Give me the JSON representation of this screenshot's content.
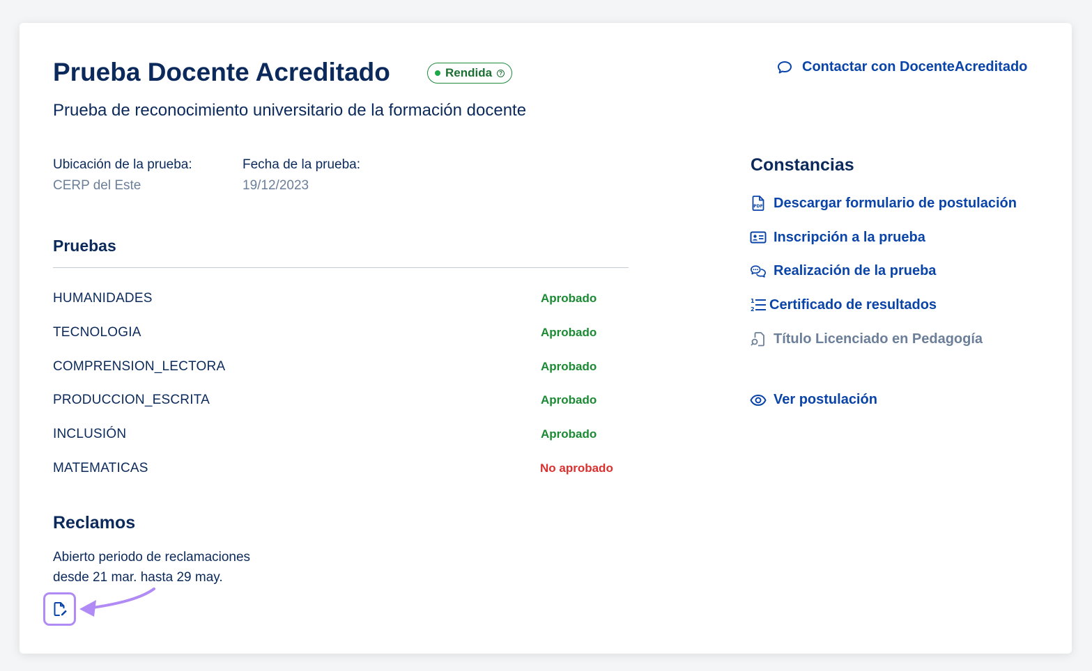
{
  "header": {
    "title": "Prueba Docente Acreditado",
    "status_badge": "Rendida",
    "status_help_icon": "question-circle-icon",
    "subtitle": "Prueba de reconocimiento universitario de la formación docente",
    "contact_link": "Contactar con DocenteAcreditado"
  },
  "meta": {
    "location_label": "Ubicación de la prueba:",
    "location_value": "CERP del Este",
    "date_label": "Fecha de la prueba:",
    "date_value": "19/12/2023"
  },
  "tests": {
    "title": "Pruebas",
    "rows": [
      {
        "name": "HUMANIDADES",
        "status": "Aprobado",
        "passed": true
      },
      {
        "name": "TECNOLOGIA",
        "status": "Aprobado",
        "passed": true
      },
      {
        "name": "COMPRENSION_LECTORA",
        "status": "Aprobado",
        "passed": true
      },
      {
        "name": "PRODUCCION_ESCRITA",
        "status": "Aprobado",
        "passed": true
      },
      {
        "name": "INCLUSIÓN",
        "status": "Aprobado",
        "passed": true
      },
      {
        "name": "MATEMATICAS",
        "status": "No aprobado",
        "passed": false
      }
    ]
  },
  "claims": {
    "title": "Reclamos",
    "line1": "Abierto periodo de reclamaciones",
    "line2": "desde 21 mar. hasta 29 may.",
    "button_icon": "file-edit-icon"
  },
  "constancias": {
    "title": "Constancias",
    "items": [
      {
        "label": "Descargar formulario de postulación",
        "icon": "pdf-file-icon",
        "enabled": true
      },
      {
        "label": "Inscripción a la prueba",
        "icon": "id-card-icon",
        "enabled": true
      },
      {
        "label": "Realización de la prueba",
        "icon": "chat-bubbles-icon",
        "enabled": true
      },
      {
        "label": "Certificado de resultados",
        "icon": "numbered-list-icon",
        "enabled": true
      },
      {
        "label": "Título Licenciado en Pedagogía",
        "icon": "document-search-icon",
        "enabled": false
      }
    ],
    "view_application": "Ver postulación"
  },
  "colors": {
    "primary": "#0a44a8",
    "heading": "#0b2a5b",
    "approved": "#1a8a33",
    "not_approved": "#d93030",
    "muted": "#6b7f99",
    "highlight": "#b18bf5"
  }
}
